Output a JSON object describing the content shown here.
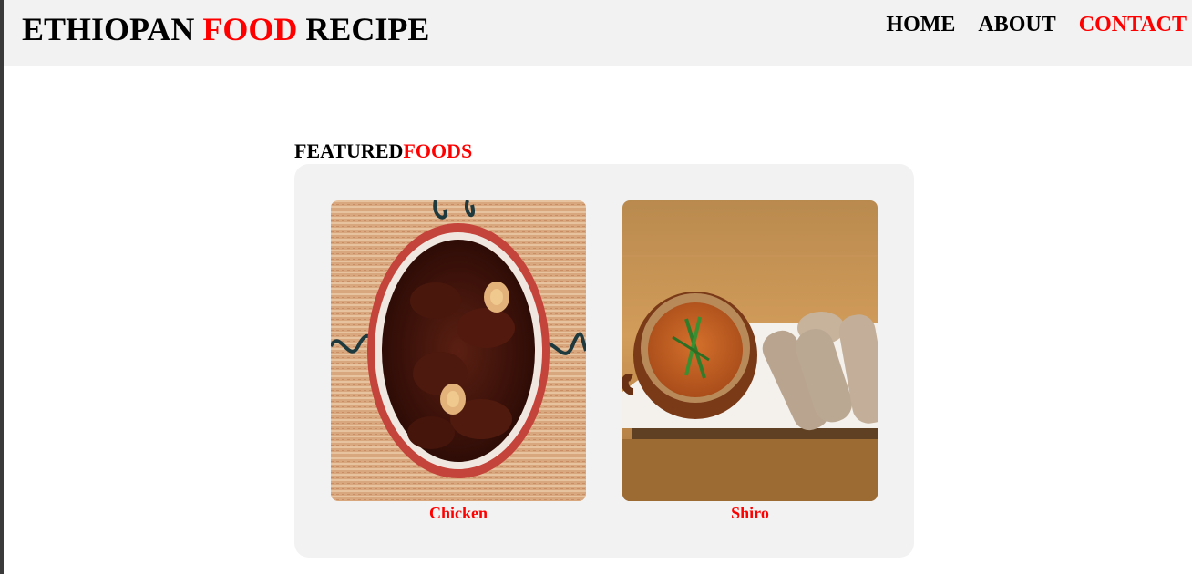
{
  "header": {
    "logo_part1": "ETHIOPAN ",
    "logo_part2": "FOOD",
    "logo_part3": " RECIPE",
    "nav": [
      {
        "label": "HOME"
      },
      {
        "label": "ABOUT"
      },
      {
        "label": "CONTACT"
      }
    ]
  },
  "featured": {
    "title_part1": "FEATURED",
    "title_part2": "FOODS",
    "items": [
      {
        "name": "Chicken",
        "image": "doro-wat-photo"
      },
      {
        "name": "Shiro",
        "image": "shiro-with-injera-photo"
      }
    ]
  },
  "colors": {
    "accent": "#ff0000",
    "header_bg": "#f2f2f2",
    "panel_bg": "#f2f2f2"
  }
}
